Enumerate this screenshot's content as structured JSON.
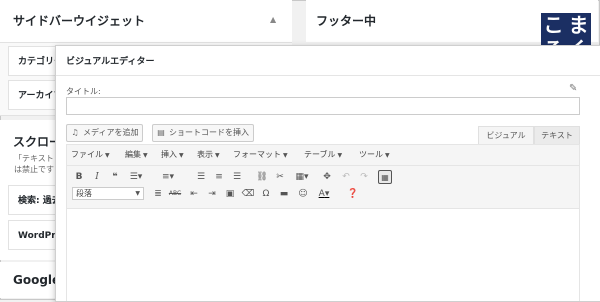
{
  "background_panels": {
    "left_panel": {
      "title": "サイドバーウイジェット",
      "collapse_arrow": "▲",
      "widgets": [
        "カテゴリー",
        "アーカイブ"
      ]
    },
    "scroll_section": {
      "title": "スクロール",
      "desc_lines": [
        "「テキスト",
        "は禁止です"
      ],
      "widgets": [
        "検索: 過去",
        "WordPre"
      ]
    },
    "google_section": {
      "title": "Google"
    },
    "right_panel": {
      "title": "フッター中"
    }
  },
  "logo": {
    "chars": [
      "こ",
      "ま",
      "ろ",
      "く"
    ],
    "bg_color": "#1b2f63"
  },
  "modal": {
    "title": "ビジュアルエディター",
    "field_label": "タイトル:",
    "title_value": "",
    "buttons": {
      "add_media": "メディアを追加",
      "insert_shortcode": "ショートコードを挿入"
    },
    "tabs": {
      "visual": "ビジュアル",
      "text": "テキスト"
    },
    "menubar": [
      "ファイル",
      "編集",
      "挿入",
      "表示",
      "フォーマット",
      "テーブル",
      "ツール"
    ],
    "format_select": "段落",
    "text_color_label": "A"
  }
}
